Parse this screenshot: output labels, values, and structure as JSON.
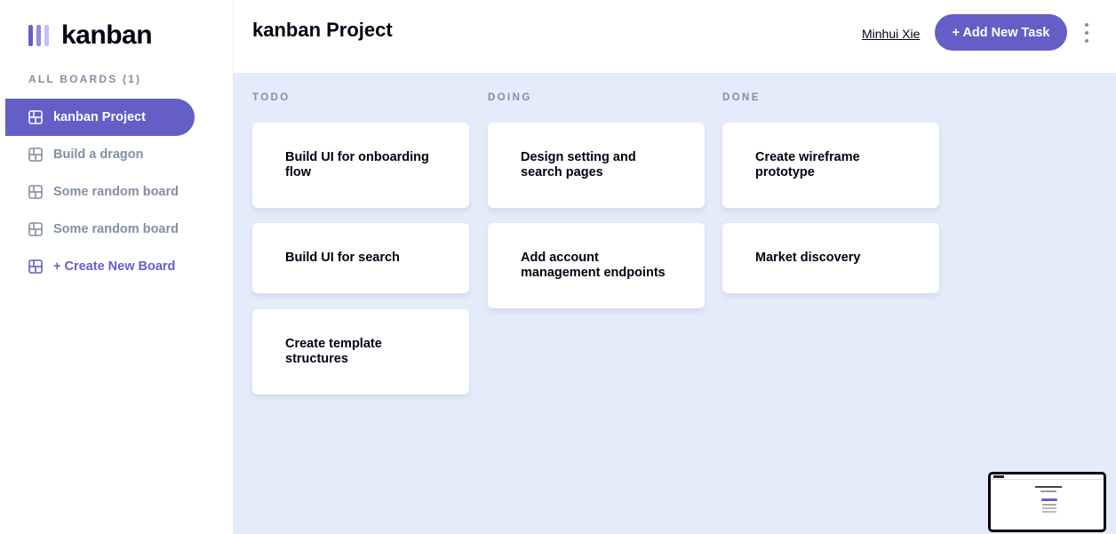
{
  "app": {
    "name": "kanban"
  },
  "sidebar": {
    "heading": "ALL BOARDS (1)",
    "boards": [
      {
        "label": "kanban Project",
        "active": true
      },
      {
        "label": "Build a dragon",
        "active": false
      },
      {
        "label": "Some random board",
        "active": false
      },
      {
        "label": "Some random board",
        "active": false
      }
    ],
    "create_label": "+ Create New Board"
  },
  "header": {
    "title": "kanban Project",
    "user": "Minhui Xie",
    "add_task_label": "+ Add New Task"
  },
  "columns": [
    {
      "title": "TODO",
      "tasks": [
        {
          "title": "Build UI for onboarding flow"
        },
        {
          "title": "Build UI for search"
        },
        {
          "title": "Create template structures"
        }
      ]
    },
    {
      "title": "DOING",
      "tasks": [
        {
          "title": "Design setting and search pages"
        },
        {
          "title": "Add account management endpoints"
        }
      ]
    },
    {
      "title": "DONE",
      "tasks": [
        {
          "title": "Create wireframe prototype"
        },
        {
          "title": "Market discovery"
        }
      ]
    }
  ],
  "colors": {
    "accent": "#635fc7",
    "board_background": "#e4ebfa",
    "muted_text": "#828fa3",
    "primary_text": "#000112"
  },
  "icons": {
    "logo": "kanban-logo-icon",
    "board": "board-layout-icon",
    "more": "vertical-ellipsis-icon"
  }
}
